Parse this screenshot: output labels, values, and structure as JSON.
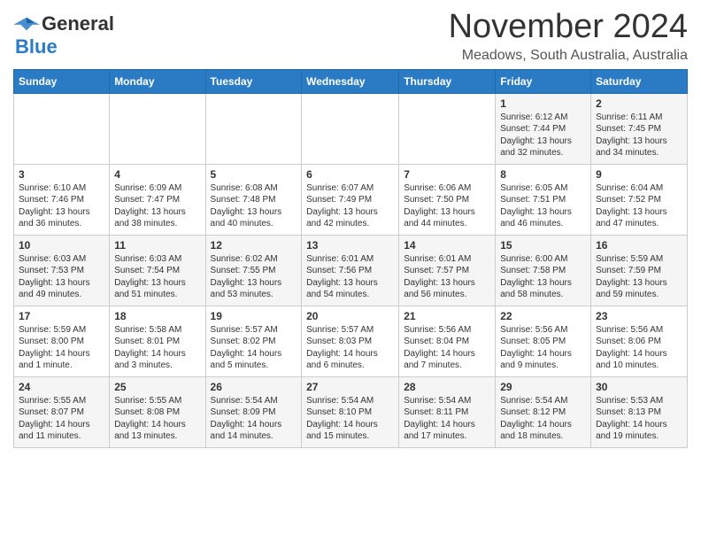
{
  "header": {
    "logo_general": "General",
    "logo_blue": "Blue",
    "month_title": "November 2024",
    "location": "Meadows, South Australia, Australia"
  },
  "weekdays": [
    "Sunday",
    "Monday",
    "Tuesday",
    "Wednesday",
    "Thursday",
    "Friday",
    "Saturday"
  ],
  "weeks": [
    [
      {
        "day": "",
        "sunrise": "",
        "sunset": "",
        "daylight": ""
      },
      {
        "day": "",
        "sunrise": "",
        "sunset": "",
        "daylight": ""
      },
      {
        "day": "",
        "sunrise": "",
        "sunset": "",
        "daylight": ""
      },
      {
        "day": "",
        "sunrise": "",
        "sunset": "",
        "daylight": ""
      },
      {
        "day": "",
        "sunrise": "",
        "sunset": "",
        "daylight": ""
      },
      {
        "day": "1",
        "sunrise": "6:12 AM",
        "sunset": "7:44 PM",
        "daylight": "13 hours and 32 minutes."
      },
      {
        "day": "2",
        "sunrise": "6:11 AM",
        "sunset": "7:45 PM",
        "daylight": "13 hours and 34 minutes."
      }
    ],
    [
      {
        "day": "3",
        "sunrise": "6:10 AM",
        "sunset": "7:46 PM",
        "daylight": "13 hours and 36 minutes."
      },
      {
        "day": "4",
        "sunrise": "6:09 AM",
        "sunset": "7:47 PM",
        "daylight": "13 hours and 38 minutes."
      },
      {
        "day": "5",
        "sunrise": "6:08 AM",
        "sunset": "7:48 PM",
        "daylight": "13 hours and 40 minutes."
      },
      {
        "day": "6",
        "sunrise": "6:07 AM",
        "sunset": "7:49 PM",
        "daylight": "13 hours and 42 minutes."
      },
      {
        "day": "7",
        "sunrise": "6:06 AM",
        "sunset": "7:50 PM",
        "daylight": "13 hours and 44 minutes."
      },
      {
        "day": "8",
        "sunrise": "6:05 AM",
        "sunset": "7:51 PM",
        "daylight": "13 hours and 46 minutes."
      },
      {
        "day": "9",
        "sunrise": "6:04 AM",
        "sunset": "7:52 PM",
        "daylight": "13 hours and 47 minutes."
      }
    ],
    [
      {
        "day": "10",
        "sunrise": "6:03 AM",
        "sunset": "7:53 PM",
        "daylight": "13 hours and 49 minutes."
      },
      {
        "day": "11",
        "sunrise": "6:03 AM",
        "sunset": "7:54 PM",
        "daylight": "13 hours and 51 minutes."
      },
      {
        "day": "12",
        "sunrise": "6:02 AM",
        "sunset": "7:55 PM",
        "daylight": "13 hours and 53 minutes."
      },
      {
        "day": "13",
        "sunrise": "6:01 AM",
        "sunset": "7:56 PM",
        "daylight": "13 hours and 54 minutes."
      },
      {
        "day": "14",
        "sunrise": "6:01 AM",
        "sunset": "7:57 PM",
        "daylight": "13 hours and 56 minutes."
      },
      {
        "day": "15",
        "sunrise": "6:00 AM",
        "sunset": "7:58 PM",
        "daylight": "13 hours and 58 minutes."
      },
      {
        "day": "16",
        "sunrise": "5:59 AM",
        "sunset": "7:59 PM",
        "daylight": "13 hours and 59 minutes."
      }
    ],
    [
      {
        "day": "17",
        "sunrise": "5:59 AM",
        "sunset": "8:00 PM",
        "daylight": "14 hours and 1 minute."
      },
      {
        "day": "18",
        "sunrise": "5:58 AM",
        "sunset": "8:01 PM",
        "daylight": "14 hours and 3 minutes."
      },
      {
        "day": "19",
        "sunrise": "5:57 AM",
        "sunset": "8:02 PM",
        "daylight": "14 hours and 5 minutes."
      },
      {
        "day": "20",
        "sunrise": "5:57 AM",
        "sunset": "8:03 PM",
        "daylight": "14 hours and 6 minutes."
      },
      {
        "day": "21",
        "sunrise": "5:56 AM",
        "sunset": "8:04 PM",
        "daylight": "14 hours and 7 minutes."
      },
      {
        "day": "22",
        "sunrise": "5:56 AM",
        "sunset": "8:05 PM",
        "daylight": "14 hours and 9 minutes."
      },
      {
        "day": "23",
        "sunrise": "5:56 AM",
        "sunset": "8:06 PM",
        "daylight": "14 hours and 10 minutes."
      }
    ],
    [
      {
        "day": "24",
        "sunrise": "5:55 AM",
        "sunset": "8:07 PM",
        "daylight": "14 hours and 11 minutes."
      },
      {
        "day": "25",
        "sunrise": "5:55 AM",
        "sunset": "8:08 PM",
        "daylight": "14 hours and 13 minutes."
      },
      {
        "day": "26",
        "sunrise": "5:54 AM",
        "sunset": "8:09 PM",
        "daylight": "14 hours and 14 minutes."
      },
      {
        "day": "27",
        "sunrise": "5:54 AM",
        "sunset": "8:10 PM",
        "daylight": "14 hours and 15 minutes."
      },
      {
        "day": "28",
        "sunrise": "5:54 AM",
        "sunset": "8:11 PM",
        "daylight": "14 hours and 17 minutes."
      },
      {
        "day": "29",
        "sunrise": "5:54 AM",
        "sunset": "8:12 PM",
        "daylight": "14 hours and 18 minutes."
      },
      {
        "day": "30",
        "sunrise": "5:53 AM",
        "sunset": "8:13 PM",
        "daylight": "14 hours and 19 minutes."
      }
    ]
  ],
  "labels": {
    "sunrise_prefix": "Sunrise: ",
    "sunset_prefix": "Sunset: ",
    "daylight_prefix": "Daylight: "
  }
}
